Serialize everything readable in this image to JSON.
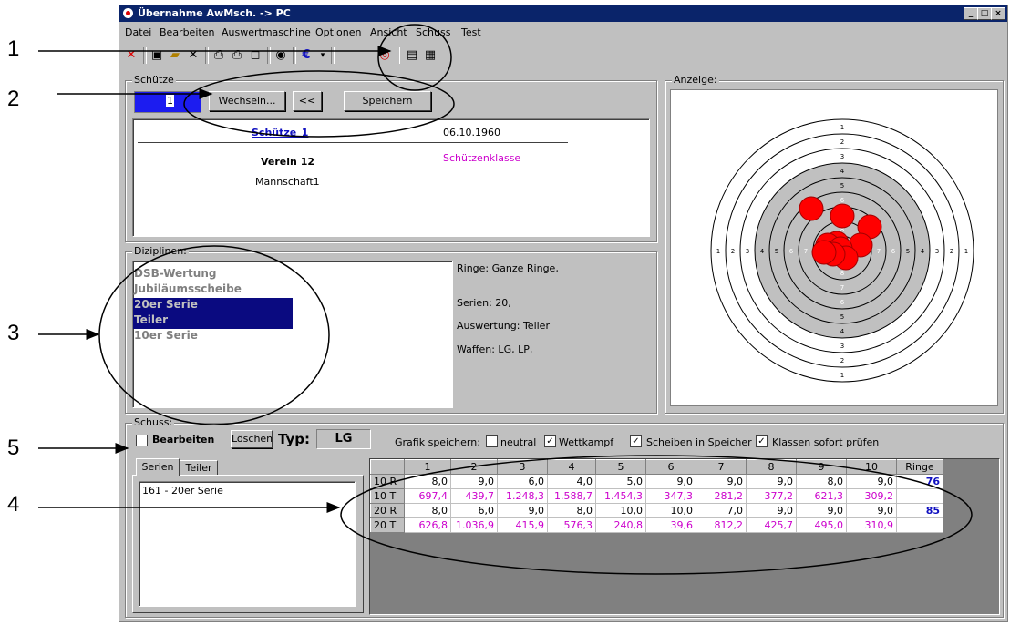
{
  "window": {
    "title": "Übernahme AwMsch. -> PC"
  },
  "menu": [
    "Datei",
    "Bearbeiten",
    "Auswertmaschine",
    "Optionen",
    "Ansicht",
    "Schuss",
    "Test"
  ],
  "toolbar": {
    "currency_symbol": "€"
  },
  "schuetze": {
    "group_label": "Schütze",
    "id_value": "1",
    "wechseln_label": "Wechseln...",
    "back_label": "<<",
    "speichern_label": "Speichern",
    "name": "Schütze_1",
    "birthdate": "06.10.1960",
    "verein": "Verein 12",
    "klasse": "Schützenklasse",
    "mannschaft": "Mannschaft1"
  },
  "disziplinen": {
    "group_label": "Diziplinen:",
    "items": [
      {
        "label": "DSB-Wertung",
        "selected": false
      },
      {
        "label": "Jubiläumsscheibe",
        "selected": false
      },
      {
        "label": "20er Serie",
        "selected": true
      },
      {
        "label": "Teiler",
        "selected": true
      },
      {
        "label": "10er Serie",
        "selected": false
      }
    ],
    "info": {
      "ringe": "Ringe: Ganze Ringe,",
      "serien": "Serien: 20,",
      "auswertung": "Auswertung: Teiler",
      "waffen": "Waffen: LG, LP,"
    }
  },
  "anzeige": {
    "group_label": "Anzeige:",
    "ring_numbers": [
      "1",
      "2",
      "3",
      "4",
      "5",
      "6",
      "7",
      "8"
    ],
    "shot_color": "#ff0000"
  },
  "schuss": {
    "group_label": "Schuss:",
    "bearbeiten_label": "Bearbeiten",
    "loeschen_label": "Löschen",
    "typ_label": "Typ:",
    "typ_value": "LG",
    "grafik_label": "Grafik speichern:",
    "options": [
      {
        "label": "neutral",
        "checked": false
      },
      {
        "label": "Wettkampf",
        "checked": true
      },
      {
        "label": "Scheiben in Speicher",
        "checked": true
      },
      {
        "label": "Klassen sofort prüfen",
        "checked": true
      }
    ],
    "tabs": [
      "Serien",
      "Teiler"
    ],
    "serien_list": [
      "161 - 20er Serie"
    ]
  },
  "table": {
    "headers": [
      "",
      "1",
      "2",
      "3",
      "4",
      "5",
      "6",
      "7",
      "8",
      "9",
      "10",
      "Ringe"
    ],
    "rows": [
      {
        "label": "10 R",
        "type": "R",
        "values": [
          "8,0",
          "9,0",
          "6,0",
          "4,0",
          "5,0",
          "9,0",
          "9,0",
          "9,0",
          "8,0",
          "9,0"
        ],
        "total": "76"
      },
      {
        "label": "10 T",
        "type": "T",
        "values": [
          "697,4",
          "439,7",
          "1.248,3",
          "1.588,7",
          "1.454,3",
          "347,3",
          "281,2",
          "377,2",
          "621,3",
          "309,2"
        ],
        "total": ""
      },
      {
        "label": "20 R",
        "type": "R",
        "values": [
          "8,0",
          "6,0",
          "9,0",
          "8,0",
          "10,0",
          "10,0",
          "7,0",
          "9,0",
          "9,0",
          "9,0"
        ],
        "total": "85"
      },
      {
        "label": "20 T",
        "type": "T",
        "values": [
          "626,8",
          "1.036,9",
          "415,9",
          "576,3",
          "240,8",
          "39,6",
          "812,2",
          "425,7",
          "495,0",
          "310,9"
        ],
        "total": ""
      }
    ]
  },
  "annotations": [
    "1",
    "2",
    "3",
    "4",
    "5"
  ]
}
